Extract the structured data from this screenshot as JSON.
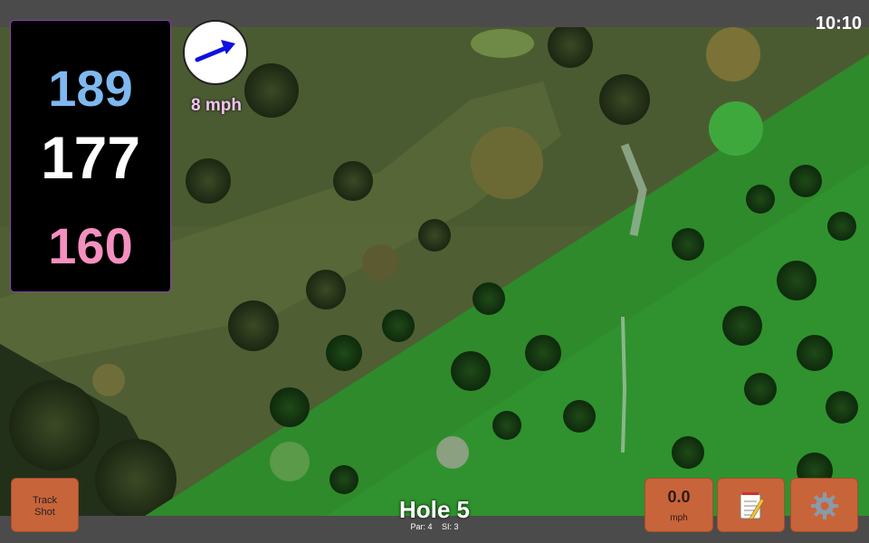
{
  "status": {
    "time": "10:10"
  },
  "distances": {
    "back": "189",
    "middle": "177",
    "front": "160"
  },
  "wind": {
    "speed": "8 mph",
    "direction_icon": "arrow-icon"
  },
  "hole": {
    "title": "Hole 5",
    "par": "Par: 4",
    "si": "SI: 3"
  },
  "buttons": {
    "track_line1": "Track",
    "track_line2": "Shot",
    "speed_value": "0.0",
    "speed_unit": "mph",
    "notes_icon": "notepad-icon",
    "settings_icon": "gear-icon"
  },
  "colors": {
    "back": "#7fb8ef",
    "middle": "#ffffff",
    "front": "#f48fbf",
    "button": "#c8643a",
    "wind_text": "#f2c3f2"
  }
}
